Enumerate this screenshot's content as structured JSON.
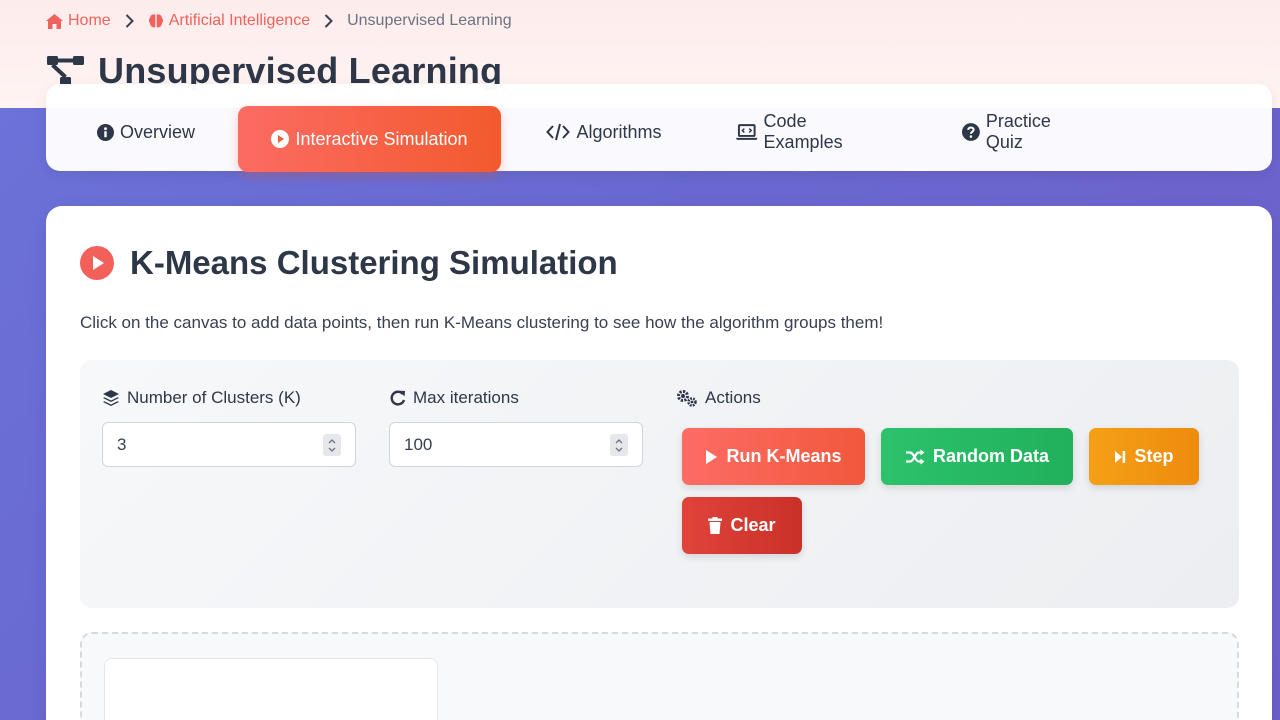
{
  "breadcrumb": {
    "home": "Home",
    "category": "Artificial Intelligence",
    "current": "Unsupervised Learning"
  },
  "page": {
    "title": "Unsupervised Learning"
  },
  "tabs": [
    {
      "label": "Overview",
      "icon": "info-circle-icon",
      "active": false
    },
    {
      "label": "Interactive Simulation",
      "icon": "play-circle-icon",
      "active": true
    },
    {
      "label": "Algorithms",
      "icon": "code-icon",
      "active": false
    },
    {
      "label": "Code Examples",
      "icon": "laptop-code-icon",
      "active": false
    },
    {
      "label": "Practice Quiz",
      "icon": "question-circle-icon",
      "active": false
    }
  ],
  "simulation": {
    "title": "K-Means Clustering Simulation",
    "description": "Click on the canvas to add data points, then run K-Means clustering to see how the algorithm groups them!",
    "clusters": {
      "label": "Number of Clusters (K)",
      "value": "3"
    },
    "iterations": {
      "label": "Max iterations",
      "value": "100"
    },
    "actions": {
      "label": "Actions",
      "run": "Run K-Means",
      "random": "Random Data",
      "step": "Step",
      "clear": "Clear"
    }
  },
  "colors": {
    "accent": "#f0625b",
    "run": "#fd6c65",
    "random": "#2cc26b",
    "step": "#f4a016",
    "clear": "#e0433a",
    "text": "#2d3748"
  }
}
